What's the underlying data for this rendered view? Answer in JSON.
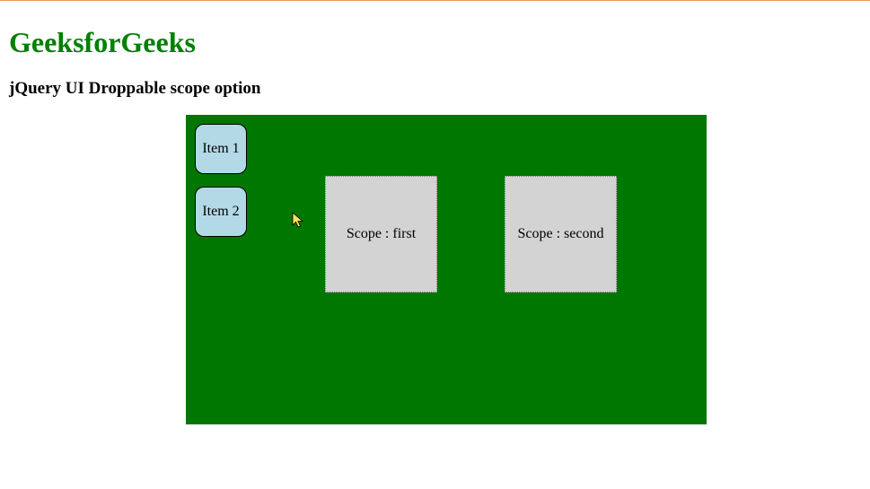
{
  "header": {
    "title": "GeeksforGeeks",
    "subtitle": "jQuery UI Droppable scope option"
  },
  "draggables": [
    {
      "label": "Item 1"
    },
    {
      "label": "Item 2"
    }
  ],
  "droppables": [
    {
      "label": "Scope : first"
    },
    {
      "label": "Scope : second"
    }
  ]
}
